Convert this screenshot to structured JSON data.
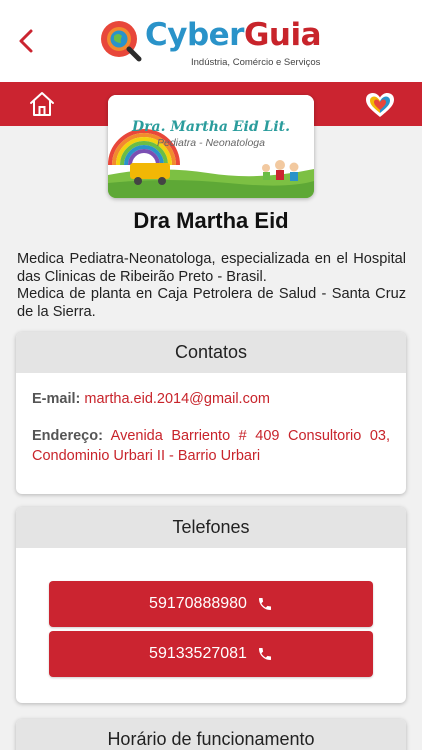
{
  "brand": {
    "name_part1": "Cyber",
    "name_part2": "Guia",
    "tagline": "Indústria, Comércio e Serviços",
    "accent": "#cb2430",
    "blue": "#2a93c9"
  },
  "nav": {
    "back_icon": "chevron-left-icon",
    "home_icon": "home-icon",
    "favorite_icon": "heart-icon"
  },
  "banner": {
    "title": "Dra. Martha Eid Lit.",
    "subtitle": "Pediatra - Neonatologa"
  },
  "profile": {
    "name": "Dra Martha Eid",
    "description_1": "Medica Pediatra-Neonatologa, especializada en el Hospital das Clinicas de Ribeirão Preto - Brasil.",
    "description_2": "Medica de planta en Caja Petrolera de Salud - Santa Cruz de la Sierra."
  },
  "contacts": {
    "header": "Contatos",
    "email_label": "E-mail:",
    "email_value": "martha.eid.2014@gmail.com",
    "address_label": "Endereço:",
    "address_value": "Avenida Barriento # 409 Consultorio 03, Condominio Urbari II - Barrio Urbari"
  },
  "phones": {
    "header": "Telefones",
    "items": [
      {
        "number": "59170888980"
      },
      {
        "number": "59133527081"
      }
    ]
  },
  "hours": {
    "header": "Horário de funcionamento"
  }
}
